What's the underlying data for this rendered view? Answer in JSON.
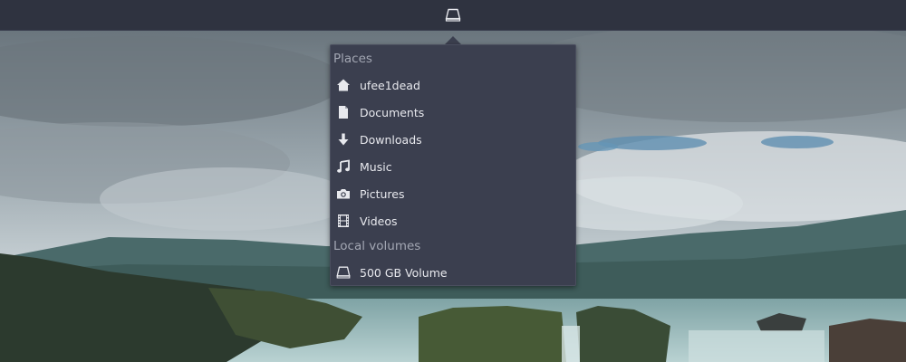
{
  "top_panel": {
    "indicator_icon": "drive-icon"
  },
  "menu": {
    "sections": [
      {
        "header": "Places",
        "items": [
          {
            "label": "ufee1dead",
            "icon": "home-icon"
          },
          {
            "label": "Documents",
            "icon": "document-icon"
          },
          {
            "label": "Downloads",
            "icon": "download-icon"
          },
          {
            "label": "Music",
            "icon": "music-icon"
          },
          {
            "label": "Pictures",
            "icon": "camera-icon"
          },
          {
            "label": "Videos",
            "icon": "film-icon"
          }
        ]
      },
      {
        "header": "Local volumes",
        "items": [
          {
            "label": "500 GB Volume",
            "icon": "drive-icon"
          }
        ]
      }
    ]
  },
  "colors": {
    "panel_bg": "#2f3340",
    "menu_bg": "#3b3f4f",
    "menu_text": "#e8e9ee",
    "section_text": "#a3a7b3",
    "icon": "#e8e9ee"
  }
}
